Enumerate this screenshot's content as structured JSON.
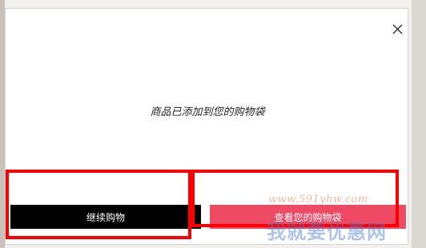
{
  "dialog": {
    "message": "商品已添加到您的购物袋",
    "close_icon": "close-icon"
  },
  "buttons": {
    "continue_label": "继续购物",
    "view_bag_label": "查看您的购物袋"
  },
  "watermark": {
    "url": "www.591yhw.com",
    "brand": "我就要优惠网"
  },
  "colors": {
    "continue_button": "#000000",
    "view_bag_button": "#ef4a64",
    "annotation": "#ff0000"
  }
}
